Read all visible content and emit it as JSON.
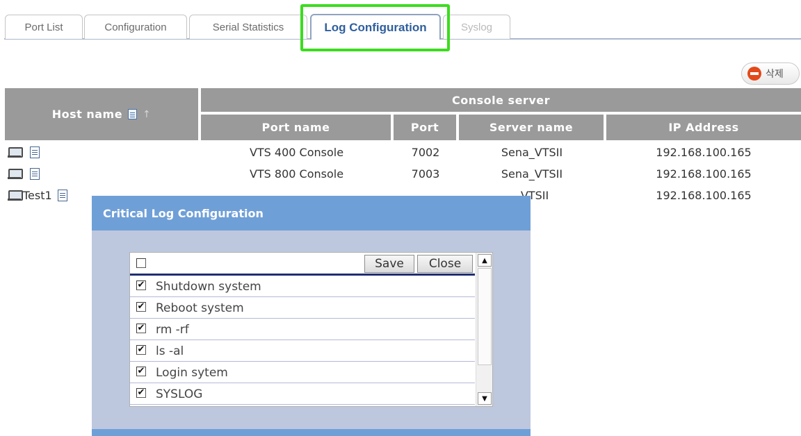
{
  "tabs": [
    {
      "label": "Port List"
    },
    {
      "label": "Configuration"
    },
    {
      "label": "Serial Statistics"
    },
    {
      "label": "Log Configuration"
    },
    {
      "label": "Syslog"
    }
  ],
  "delete_button": {
    "label": "삭제"
  },
  "table": {
    "host_header": "Host name",
    "console_header": "Console server",
    "columns": [
      "Port name",
      "Port",
      "Server name",
      "IP Address"
    ],
    "rows": [
      {
        "host": "",
        "port_name": "VTS 400 Console",
        "port": "7002",
        "server_name": "Sena_VTSII",
        "ip": "192.168.100.165"
      },
      {
        "host": "",
        "port_name": "VTS 800 Console",
        "port": "7003",
        "server_name": "Sena_VTSII",
        "ip": "192.168.100.165"
      },
      {
        "host": "Test1",
        "port_name": "",
        "port": "",
        "server_name": "_VTSII",
        "ip": "192.168.100.165"
      }
    ]
  },
  "modal": {
    "title": "Critical Log Configuration",
    "save_label": "Save",
    "close_label": "Close",
    "select_all_checked": false,
    "items": [
      {
        "label": "Shutdown system",
        "checked": true
      },
      {
        "label": "Reboot system",
        "checked": true
      },
      {
        "label": "rm -rf",
        "checked": true
      },
      {
        "label": "ls -al",
        "checked": true
      },
      {
        "label": "Login sytem",
        "checked": true
      },
      {
        "label": "SYSLOG",
        "checked": true
      }
    ]
  },
  "colors": {
    "highlight": "#3cdc1e",
    "table_header": "#9a9a9a",
    "modal_header": "#6f9fd7",
    "modal_body": "#bdc8de",
    "active_tab_text": "#2f5f9c"
  }
}
